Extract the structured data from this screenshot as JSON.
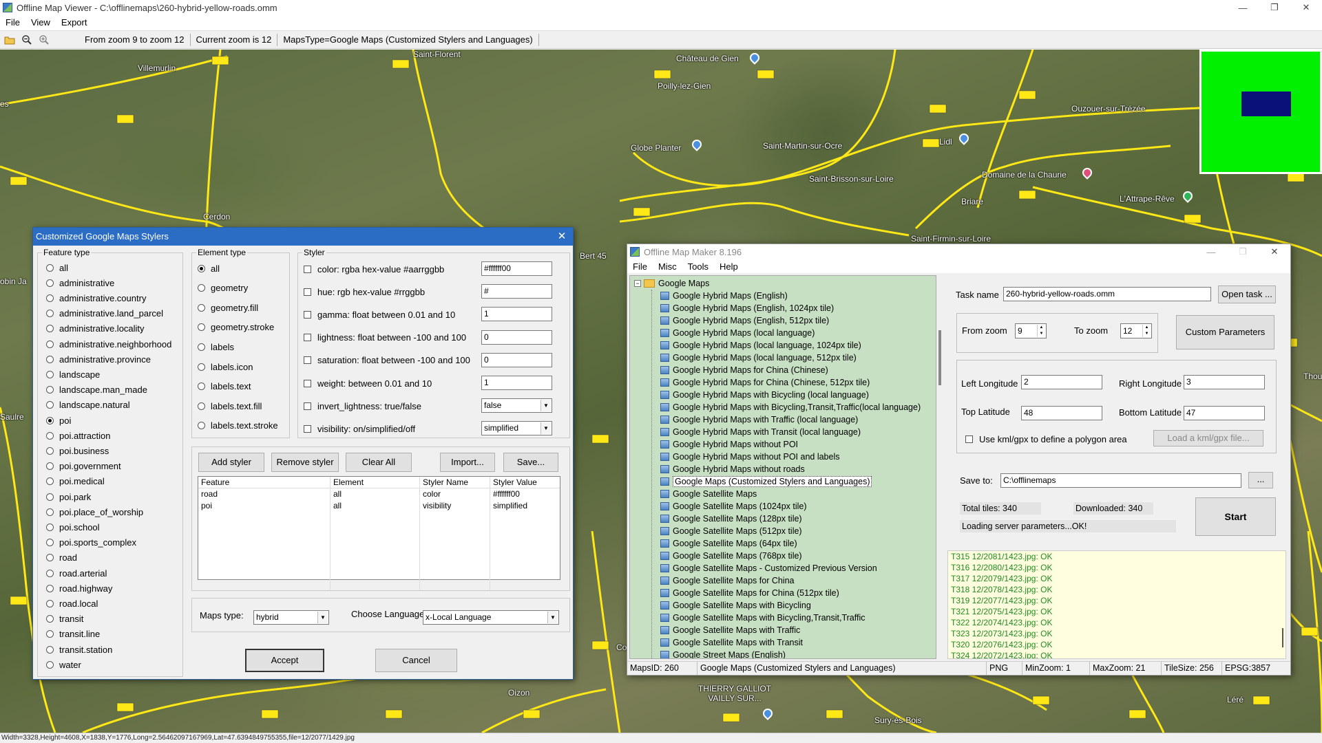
{
  "window": {
    "title": "Offline Map Viewer - C:\\offlinemaps\\260-hybrid-yellow-roads.omm",
    "minimize": "—",
    "maximize": "❐",
    "close": "✕"
  },
  "menu": [
    "File",
    "View",
    "Export"
  ],
  "toolbar": {
    "icons": [
      "open-folder-icon",
      "zoom-out-icon",
      "zoom-in-icon"
    ],
    "zoom_range": "From zoom 9 to zoom 12",
    "current_zoom": "Current zoom is 12",
    "maps_type": "MapsType=Google Maps (Customized Stylers and Languages)"
  },
  "map": {
    "places": [
      "Villemurlin",
      "Saint-Florent",
      "Château de Gien",
      "Poilly-lez-Gien",
      "Globe Planter",
      "Saint-Martin-sur-Ocre",
      "Lidl",
      "Ouzouer-sur-Trézée",
      "Saint-Brisson-sur-Loire",
      "Domaine de la Chaurie",
      "Briare",
      "L'Attrape-Rêve",
      "Cerdon",
      "Saint-Firmin-sur-Loire",
      "Bert 45",
      "Thou",
      "obin Ja",
      "Saulre",
      "Oizon",
      "THIERRY GALLIOT VAILLY SUR...",
      "Sury-ès-Bois",
      "Léré",
      "es",
      "Co"
    ]
  },
  "status_bar": "Width=3328,Height=4608,X=1838,Y=1776,Long=2.56462097167969,Lat=47.6394849755355,file=12/2077/1429.jpg",
  "styler_dialog": {
    "title": "Customized Google Maps Stylers",
    "close": "✕",
    "feature_type": {
      "label": "Feature type",
      "selected": "poi",
      "items": [
        "all",
        "administrative",
        "administrative.country",
        "administrative.land_parcel",
        "administrative.locality",
        "administrative.neighborhood",
        "administrative.province",
        "landscape",
        "landscape.man_made",
        "landscape.natural",
        "poi",
        "poi.attraction",
        "poi.business",
        "poi.government",
        "poi.medical",
        "poi.park",
        "poi.place_of_worship",
        "poi.school",
        "poi.sports_complex",
        "road",
        "road.arterial",
        "road.highway",
        "road.local",
        "transit",
        "transit.line",
        "transit.station",
        "water"
      ]
    },
    "element_type": {
      "label": "Element type",
      "selected": "all",
      "items": [
        "all",
        "geometry",
        "geometry.fill",
        "geometry.stroke",
        "labels",
        "labels.icon",
        "labels.text",
        "labels.text.fill",
        "labels.text.stroke"
      ]
    },
    "styler": {
      "label": "Styler",
      "rows": [
        {
          "label": "color: rgba hex-value #aarrggbb",
          "value": "#ffffff00",
          "kind": "text"
        },
        {
          "label": "hue: rgb hex-value #rrggbb",
          "value": "#",
          "kind": "text"
        },
        {
          "label": "gamma: float between 0.01 and 10",
          "value": "1",
          "kind": "text"
        },
        {
          "label": "lightness: float between -100 and 100",
          "value": "0",
          "kind": "text"
        },
        {
          "label": "saturation: float between -100 and 100",
          "value": "0",
          "kind": "text"
        },
        {
          "label": "weight: between 0.01 and  10",
          "value": "1",
          "kind": "text"
        },
        {
          "label": "invert_lightness: true/false",
          "value": "false",
          "kind": "combo"
        },
        {
          "label": "visibility: on/simplified/off",
          "value": "simplified",
          "kind": "combo"
        }
      ]
    },
    "buttons": {
      "add": "Add styler",
      "remove": "Remove styler",
      "clear": "Clear All",
      "import": "Import...",
      "save": "Save..."
    },
    "table": {
      "headers": [
        "Feature",
        "Element",
        "Styler Name",
        "Styler Value"
      ],
      "rows": [
        [
          "road",
          "all",
          "color",
          "#ffffff00"
        ],
        [
          "poi",
          "all",
          "visibility",
          "simplified"
        ]
      ]
    },
    "maps_type_label": "Maps type:",
    "maps_type_value": "hybrid",
    "language_label": "Choose Language:",
    "language_value": "x-Local Language",
    "accept": "Accept",
    "cancel": "Cancel"
  },
  "maker": {
    "title": "Offline Map Maker 8.196",
    "menu": [
      "File",
      "Misc",
      "Tools",
      "Help"
    ],
    "tree_root": "Google Maps",
    "tree_selected": "Google Maps (Customized Stylers and Languages)",
    "tree_items": [
      "Google Hybrid Maps (English)",
      "Google Hybrid Maps (English, 1024px tile)",
      "Google Hybrid Maps (English, 512px tile)",
      "Google Hybrid Maps (local language)",
      "Google Hybrid Maps (local language, 1024px tile)",
      "Google Hybrid Maps (local language, 512px tile)",
      "Google Hybrid Maps for China (Chinese)",
      "Google Hybrid Maps for China (Chinese, 512px tile)",
      "Google Hybrid Maps with Bicycling (local language)",
      "Google Hybrid Maps with Bicycling,Transit,Traffic(local language)",
      "Google Hybrid Maps with Traffic (local language)",
      "Google Hybrid Maps with Transit (local language)",
      "Google Hybrid Maps without POI",
      "Google Hybrid Maps without POI and labels",
      "Google Hybrid Maps without roads",
      "Google Maps (Customized Stylers and Languages)",
      "Google Satellite Maps",
      "Google Satellite Maps (1024px tile)",
      "Google Satellite Maps (128px tile)",
      "Google Satellite Maps (512px tile)",
      "Google Satellite Maps (64px tile)",
      "Google Satellite Maps (768px tile)",
      "Google Satellite Maps - Customized Previous Version",
      "Google Satellite Maps for China",
      "Google Satellite Maps for China (512px tile)",
      "Google Satellite Maps with Bicycling",
      "Google Satellite Maps with Bicycling,Transit,Traffic",
      "Google Satellite Maps with Traffic",
      "Google Satellite Maps with Transit",
      "Google Street Maps (English)"
    ],
    "task_name_label": "Task name",
    "task_name": "260-hybrid-yellow-roads.omm",
    "open_task": "Open task ...",
    "from_zoom_label": "From zoom",
    "from_zoom": "9",
    "to_zoom_label": "To zoom",
    "to_zoom": "12",
    "custom_params": "Custom Parameters",
    "left_lon_label": "Left Longitude",
    "left_lon": "2",
    "right_lon_label": "Right Longitude",
    "right_lon": "3",
    "top_lat_label": "Top Latitude",
    "top_lat": "48",
    "bottom_lat_label": "Bottom Latitude",
    "bottom_lat": "47",
    "use_kml": "Use kml/gpx to define a polygon area",
    "load_kml": "Load a kml/gpx file...",
    "save_to_label": "Save to:",
    "save_to": "C:\\offlinemaps",
    "browse": "...",
    "total_tiles": "Total tiles: 340",
    "downloaded": "Downloaded: 340",
    "loading": "Loading server parameters...OK!",
    "start": "Start",
    "log": [
      "T315 12/2081/1423.jpg: OK",
      "T316 12/2080/1423.jpg: OK",
      "T317 12/2079/1423.jpg: OK",
      "T318 12/2078/1423.jpg: OK",
      "T319 12/2077/1423.jpg: OK",
      "T321 12/2075/1423.jpg: OK",
      "T322 12/2074/1423.jpg: OK",
      "T323 12/2073/1423.jpg: OK",
      "T320 12/2076/1423.jpg: OK",
      "T324 12/2072/1423.jpg: OK"
    ],
    "status": {
      "maps_id": "MapsID: 260",
      "maps_name": "Google Maps (Customized Stylers and Languages)",
      "format": "PNG",
      "min_zoom": "MinZoom: 1",
      "max_zoom": "MaxZoom: 21",
      "tile_size": "TileSize: 256",
      "epsg": "EPSG:3857"
    }
  }
}
